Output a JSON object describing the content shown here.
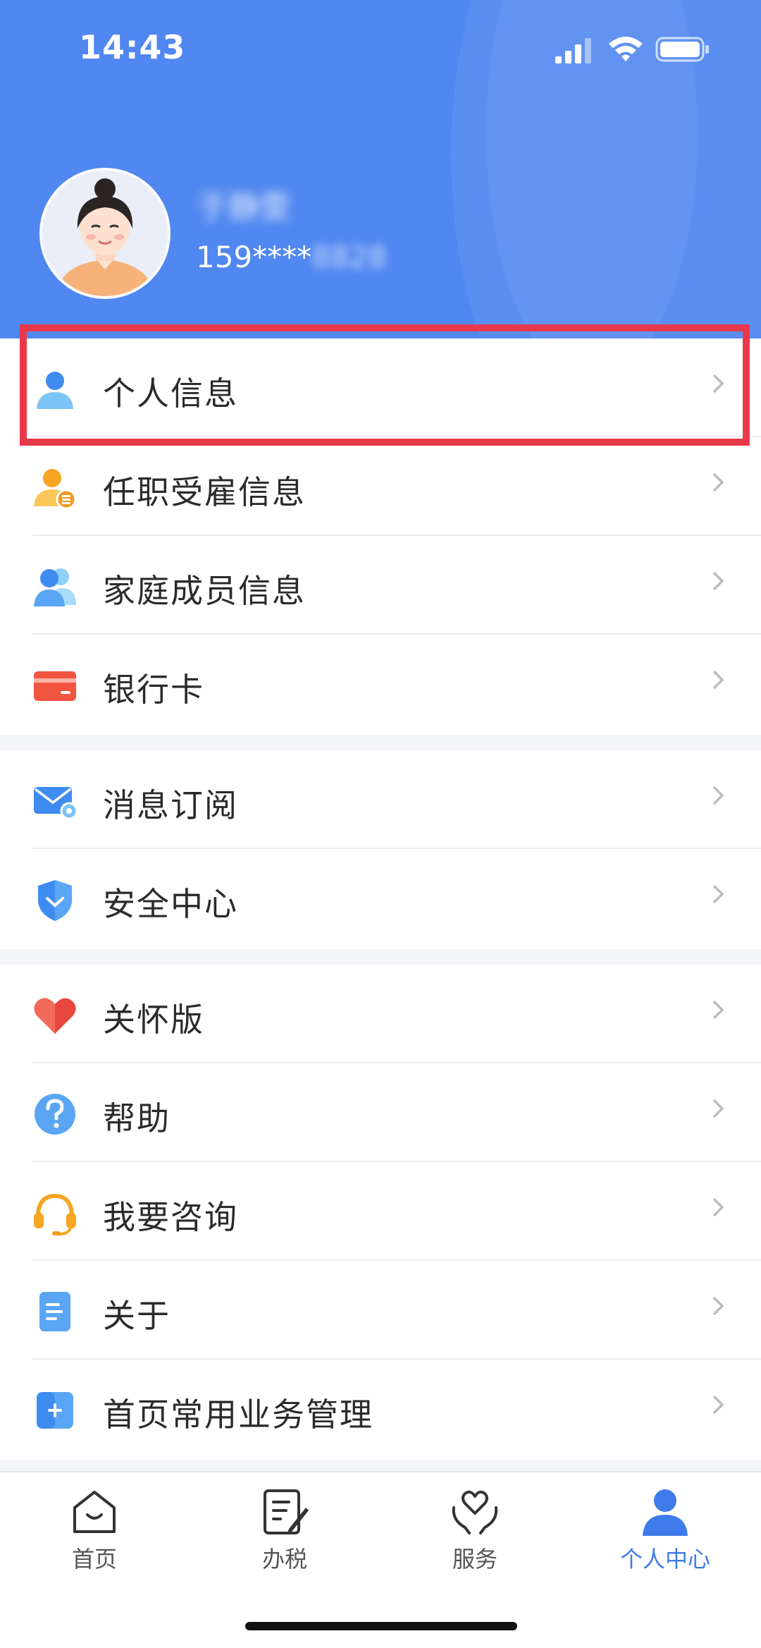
{
  "status_bar": {
    "time": "14:43"
  },
  "profile": {
    "name": "于静雯",
    "phone_visible": "159****",
    "phone_masked": "8828"
  },
  "menu_groups": [
    {
      "items": [
        {
          "label": "个人信息",
          "icon": "person-icon"
        },
        {
          "label": "任职受雇信息",
          "icon": "employment-icon"
        },
        {
          "label": "家庭成员信息",
          "icon": "family-icon"
        },
        {
          "label": "银行卡",
          "icon": "bank-card-icon"
        }
      ]
    },
    {
      "items": [
        {
          "label": "消息订阅",
          "icon": "mail-settings-icon"
        },
        {
          "label": "安全中心",
          "icon": "shield-icon"
        }
      ]
    },
    {
      "items": [
        {
          "label": "关怀版",
          "icon": "heart-icon"
        },
        {
          "label": "帮助",
          "icon": "question-icon"
        },
        {
          "label": "我要咨询",
          "icon": "headset-icon"
        },
        {
          "label": "关于",
          "icon": "document-icon"
        },
        {
          "label": "首页常用业务管理",
          "icon": "plus-square-icon"
        }
      ]
    }
  ],
  "tabbar": {
    "tabs": [
      {
        "label": "首页",
        "icon": "home-icon",
        "active": false
      },
      {
        "label": "办税",
        "icon": "tax-form-icon",
        "active": false
      },
      {
        "label": "服务",
        "icon": "heart-hands-icon",
        "active": false
      },
      {
        "label": "个人中心",
        "icon": "profile-icon",
        "active": true
      }
    ]
  },
  "colors": {
    "header_blue": "#5087f0",
    "highlight_red": "#e8394b",
    "active_tab": "#3f7bea"
  }
}
